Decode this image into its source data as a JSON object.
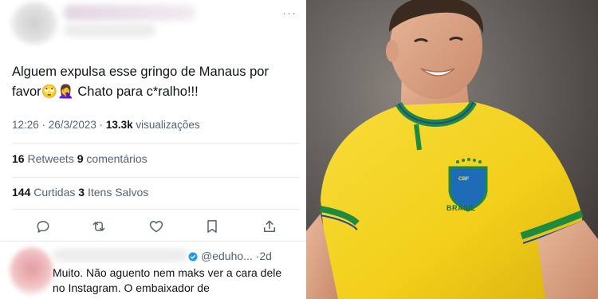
{
  "tweet": {
    "text_line1": "Alguem expulsa esse gringo de Manaus por",
    "text_line2_a": "favor",
    "text_line2_emoji": "🙄🤦‍♀️",
    "text_line2_b": " Chato para c*ralho!!!",
    "time": "12:26 · 26/3/2023 · ",
    "views_count": "13.3k",
    "views_label": " visualizações",
    "retweets_count": "16",
    "retweets_label": " Retweets ",
    "comments_count": "9",
    "comments_label": " comentários",
    "likes_count": "144",
    "likes_label": " Curtidas ",
    "saves_count": "3",
    "saves_label": " Itens Salvos",
    "more_icon": "···"
  },
  "reply": {
    "handle": "@eduho... ·2d",
    "text": "Muito. Não aguento nem maks ver a cara dele no Instagram. O embaixador de"
  },
  "photo": {
    "badge_text": "CBF",
    "shirt_text": "BRASIL"
  },
  "colors": {
    "muted": "#536471",
    "shirt_yellow": "#f4d51f",
    "shirt_green": "#1e8a3e",
    "shirt_blue": "#2443a0"
  }
}
